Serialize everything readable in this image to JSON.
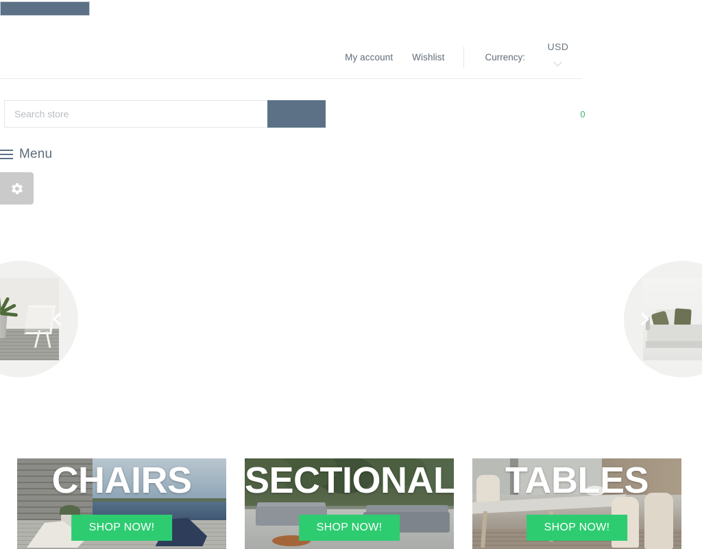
{
  "branding": {
    "logo_placeholder": "",
    "accent_slate": "#5c7186",
    "accent_green": "#2ecc71",
    "cart_badge_green": "#37b36b"
  },
  "header": {
    "links": [
      {
        "label": "My account",
        "name": "my-account-link"
      },
      {
        "label": "Wishlist",
        "name": "wishlist-link"
      }
    ],
    "currency_label": "Currency:",
    "currency_value": "USD",
    "currency_options": [
      "USD"
    ],
    "chevron_icon": "chevron-down-icon"
  },
  "search": {
    "placeholder": "Search store",
    "value": "",
    "button_label": "",
    "button_icon": "search-icon"
  },
  "cart": {
    "quantity": "0",
    "icon": "shopping-cart-icon"
  },
  "menu": {
    "label": "Menu",
    "icon": "hamburger-menu-icon"
  },
  "settings": {
    "icon": "gear-icon",
    "label": ""
  },
  "carousel": {
    "prev_icon": "chevron-left-icon",
    "next_icon": "chevron-right-icon",
    "slides": [
      {
        "alt": "plant-and-white-chair-on-deck"
      },
      {
        "alt": "white-sofa-with-olive-cushions"
      }
    ]
  },
  "categories": [
    {
      "title": "CHAIRS",
      "cta": "SHOP NOW!",
      "name": "category-tile-chairs",
      "image_alt": "deck-loungers-by-lake"
    },
    {
      "title": "SECTIONALS",
      "cta": "SHOP NOW!",
      "name": "category-tile-sectionals",
      "image_alt": "gray-outdoor-sectional-sofas-in-garden"
    },
    {
      "title": "TABLES",
      "cta": "SHOP NOW!",
      "name": "category-tile-tables",
      "image_alt": "outdoor-dining-table-and-chairs"
    }
  ]
}
